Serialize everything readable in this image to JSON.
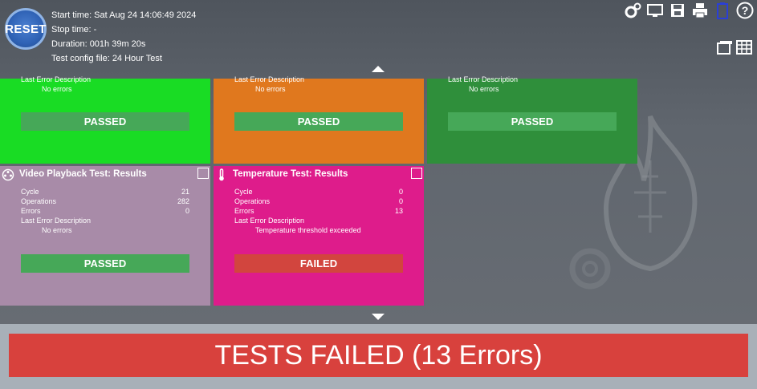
{
  "reset_label": "RESET",
  "session": {
    "start_time": "Start time: Sat Aug 24 14:06:49 2024",
    "stop_time": "Stop time: -",
    "duration": "Duration: 001h 39m 20s",
    "config_file": "Test config file: 24 Hour Test"
  },
  "toolbar": {
    "icons": [
      "settings-icon",
      "monitor-icon",
      "save-icon",
      "print-icon",
      "battery-icon",
      "help-icon"
    ],
    "help_symbol": "?"
  },
  "colors": {
    "tile_green": "#19dc24",
    "tile_orange": "#e0781e",
    "tile_darkgreen": "#2f8f3b",
    "tile_lavender": "#a88ba8",
    "tile_magenta": "#de1c8b",
    "passed": "#46a858",
    "failed": "#d2453e",
    "banner": "#d8413d"
  },
  "tiles_top": [
    {
      "err_label": "Last Error Description",
      "err_value": "No errors",
      "status": "PASSED"
    },
    {
      "err_label": "Last Error Description",
      "err_value": "No errors",
      "status": "PASSED"
    },
    {
      "err_label": "Last Error Description",
      "err_value": "No errors",
      "status": "PASSED"
    }
  ],
  "video_tile": {
    "title": "Video Playback Test: Results",
    "cycle_label": "Cycle",
    "cycle": "21",
    "ops_label": "Operations",
    "ops": "282",
    "errors_label": "Errors",
    "errors": "0",
    "err_label": "Last Error Description",
    "err_value": "No errors",
    "status": "PASSED"
  },
  "temperature_tile": {
    "title": "Temperature Test: Results",
    "cycle_label": "Cycle",
    "cycle": "0",
    "ops_label": "Operations",
    "ops": "0",
    "errors_label": "Errors",
    "errors": "13",
    "err_label": "Last Error Description",
    "err_value": "Temperature threshold exceeded",
    "status": "FAILED"
  },
  "banner": "TESTS FAILED (13 Errors)"
}
